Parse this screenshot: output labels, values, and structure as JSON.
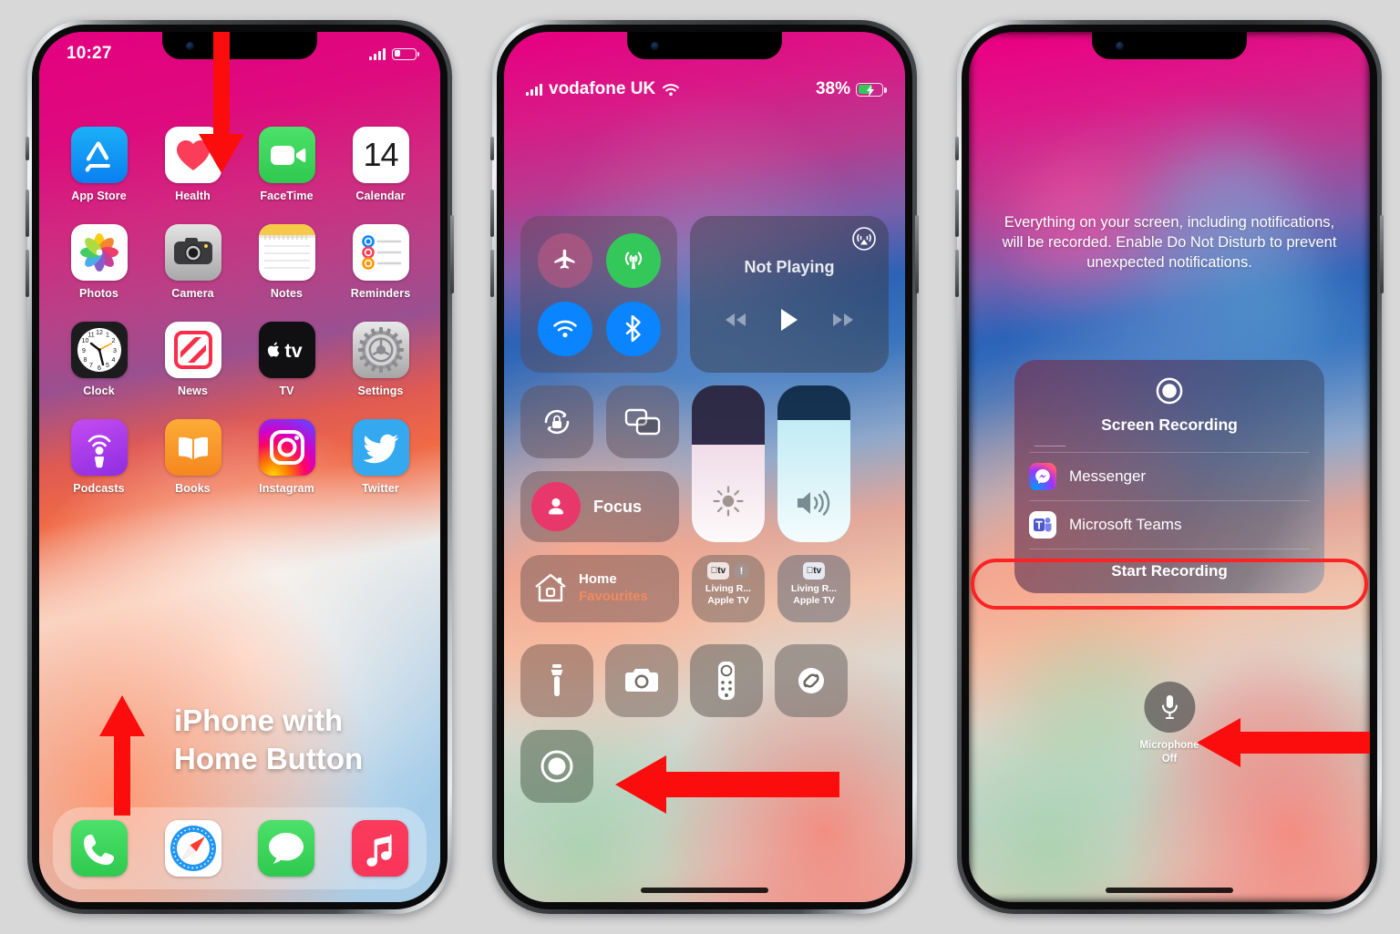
{
  "phone1": {
    "status": {
      "time": "10:27",
      "signal_icon": "cellular-bars-icon",
      "battery_icon": "battery-low-icon"
    },
    "apps": [
      {
        "label": "App Store",
        "icon": "app-store-icon"
      },
      {
        "label": "Health",
        "icon": "health-icon"
      },
      {
        "label": "FaceTime",
        "icon": "facetime-icon"
      },
      {
        "label": "Calendar",
        "icon": "calendar-icon",
        "day": "14"
      },
      {
        "label": "Photos",
        "icon": "photos-icon"
      },
      {
        "label": "Camera",
        "icon": "camera-icon"
      },
      {
        "label": "Notes",
        "icon": "notes-icon"
      },
      {
        "label": "Reminders",
        "icon": "reminders-icon"
      },
      {
        "label": "Clock",
        "icon": "clock-icon"
      },
      {
        "label": "News",
        "icon": "news-icon"
      },
      {
        "label": "TV",
        "icon": "apple-tv-icon"
      },
      {
        "label": "Settings",
        "icon": "settings-gear-icon"
      },
      {
        "label": "Podcasts",
        "icon": "podcasts-icon"
      },
      {
        "label": "Books",
        "icon": "books-icon"
      },
      {
        "label": "Instagram",
        "icon": "instagram-icon"
      },
      {
        "label": "Twitter",
        "icon": "twitter-icon"
      }
    ],
    "dock": [
      {
        "label": "Phone",
        "icon": "phone-icon"
      },
      {
        "label": "Safari",
        "icon": "safari-compass-icon"
      },
      {
        "label": "Messages",
        "icon": "messages-bubble-icon"
      },
      {
        "label": "Music",
        "icon": "music-note-icon"
      }
    ],
    "overlay_line1": "iPhone with",
    "overlay_line2": "Home Button",
    "annotations": {
      "down_arrow": "red-down-arrow",
      "up_arrow": "red-up-arrow"
    }
  },
  "phone2": {
    "status": {
      "carrier": "vodafone UK",
      "signal_icon": "cellular-bars-icon",
      "wifi_icon": "wifi-icon",
      "battery_percent": "38%",
      "battery_icon": "battery-charging-icon"
    },
    "connectivity": [
      {
        "name": "airplane-mode-toggle",
        "icon": "airplane-icon",
        "state": "off"
      },
      {
        "name": "cellular-data-toggle",
        "icon": "cellular-antenna-icon",
        "state": "on"
      },
      {
        "name": "wifi-toggle",
        "icon": "wifi-icon",
        "state": "on"
      },
      {
        "name": "bluetooth-toggle",
        "icon": "bluetooth-icon",
        "state": "on"
      }
    ],
    "media": {
      "title": "Not Playing",
      "airplay_icon": "airplay-audio-icon",
      "prev": "rewind-icon",
      "play": "play-icon",
      "next": "fast-forward-icon"
    },
    "rotation_lock": {
      "icon": "rotation-lock-icon"
    },
    "screen_mirroring": {
      "icon": "screen-mirroring-icon"
    },
    "focus": {
      "label": "Focus",
      "icon": "focus-person-icon"
    },
    "brightness": {
      "icon": "brightness-sun-icon",
      "level": 62
    },
    "volume": {
      "icon": "volume-speaker-icon",
      "level": 78
    },
    "home": {
      "line1": "Home",
      "line2": "Favourites",
      "icon": "home-house-icon"
    },
    "apple_tv": [
      {
        "line1": "Living R...",
        "line2": "Apple TV",
        "icon": "apple-tv-badge-icon",
        "warning": "!"
      },
      {
        "line1": "Living R...",
        "line2": "Apple TV",
        "icon": "apple-tv-badge-icon",
        "warning": ""
      }
    ],
    "utilities": [
      {
        "name": "flashlight-button",
        "icon": "flashlight-icon"
      },
      {
        "name": "camera-button",
        "icon": "camera-icon"
      },
      {
        "name": "apple-tv-remote-button",
        "icon": "remote-control-icon"
      },
      {
        "name": "shazam-button",
        "icon": "shazam-icon"
      }
    ],
    "screen_record": {
      "name": "screen-record-button",
      "icon": "record-circle-icon"
    },
    "annotations": {
      "left_arrow": "red-left-arrow"
    }
  },
  "phone3": {
    "notice": "Everything on your screen, including notifications, will be recorded. Enable Do Not Disturb to prevent unexpected notifications.",
    "panel": {
      "title": "Screen Recording",
      "icon": "record-circle-icon",
      "apps": [
        {
          "label": "Messenger",
          "icon": "messenger-icon"
        },
        {
          "label": "Microsoft Teams",
          "icon": "microsoft-teams-icon"
        }
      ],
      "start_button": "Start Recording"
    },
    "microphone": {
      "icon": "microphone-icon",
      "line1": "Microphone",
      "line2": "Off"
    },
    "annotations": {
      "left_arrow": "red-left-arrow",
      "highlight_ring": "red-highlight-ring"
    }
  },
  "colors": {
    "accent_red": "#fb0d0d",
    "background": "#d8d8d8",
    "toggle_blue": "#0a84ff",
    "toggle_green": "#34c759",
    "focus_pink": "#e8386b",
    "favourites_orange": "#f08a5f"
  }
}
